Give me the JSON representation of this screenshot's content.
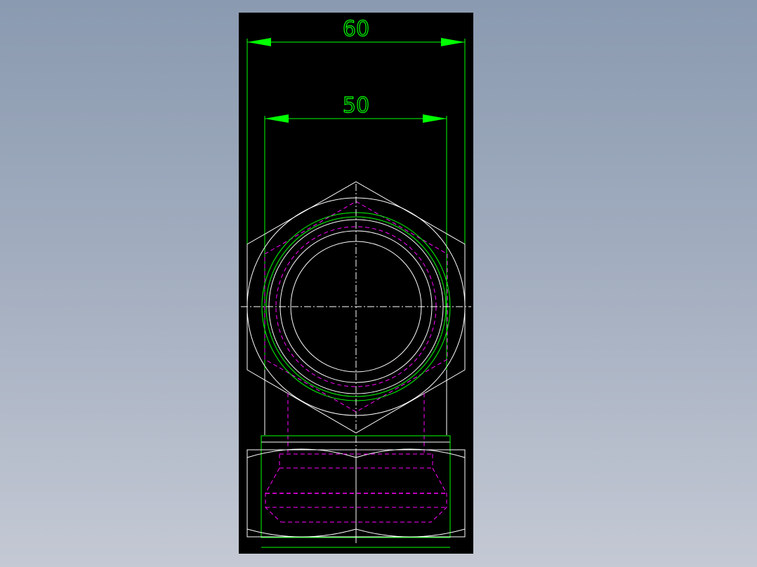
{
  "drawing": {
    "dimensions": [
      {
        "label": "60",
        "value": 60
      },
      {
        "label": "50",
        "value": 50
      }
    ],
    "colors": {
      "background": "#000000",
      "outline": "#ffffff",
      "dimension": "#00ff00",
      "hidden": "#ff00ff",
      "centerline": "#ffffff"
    }
  }
}
